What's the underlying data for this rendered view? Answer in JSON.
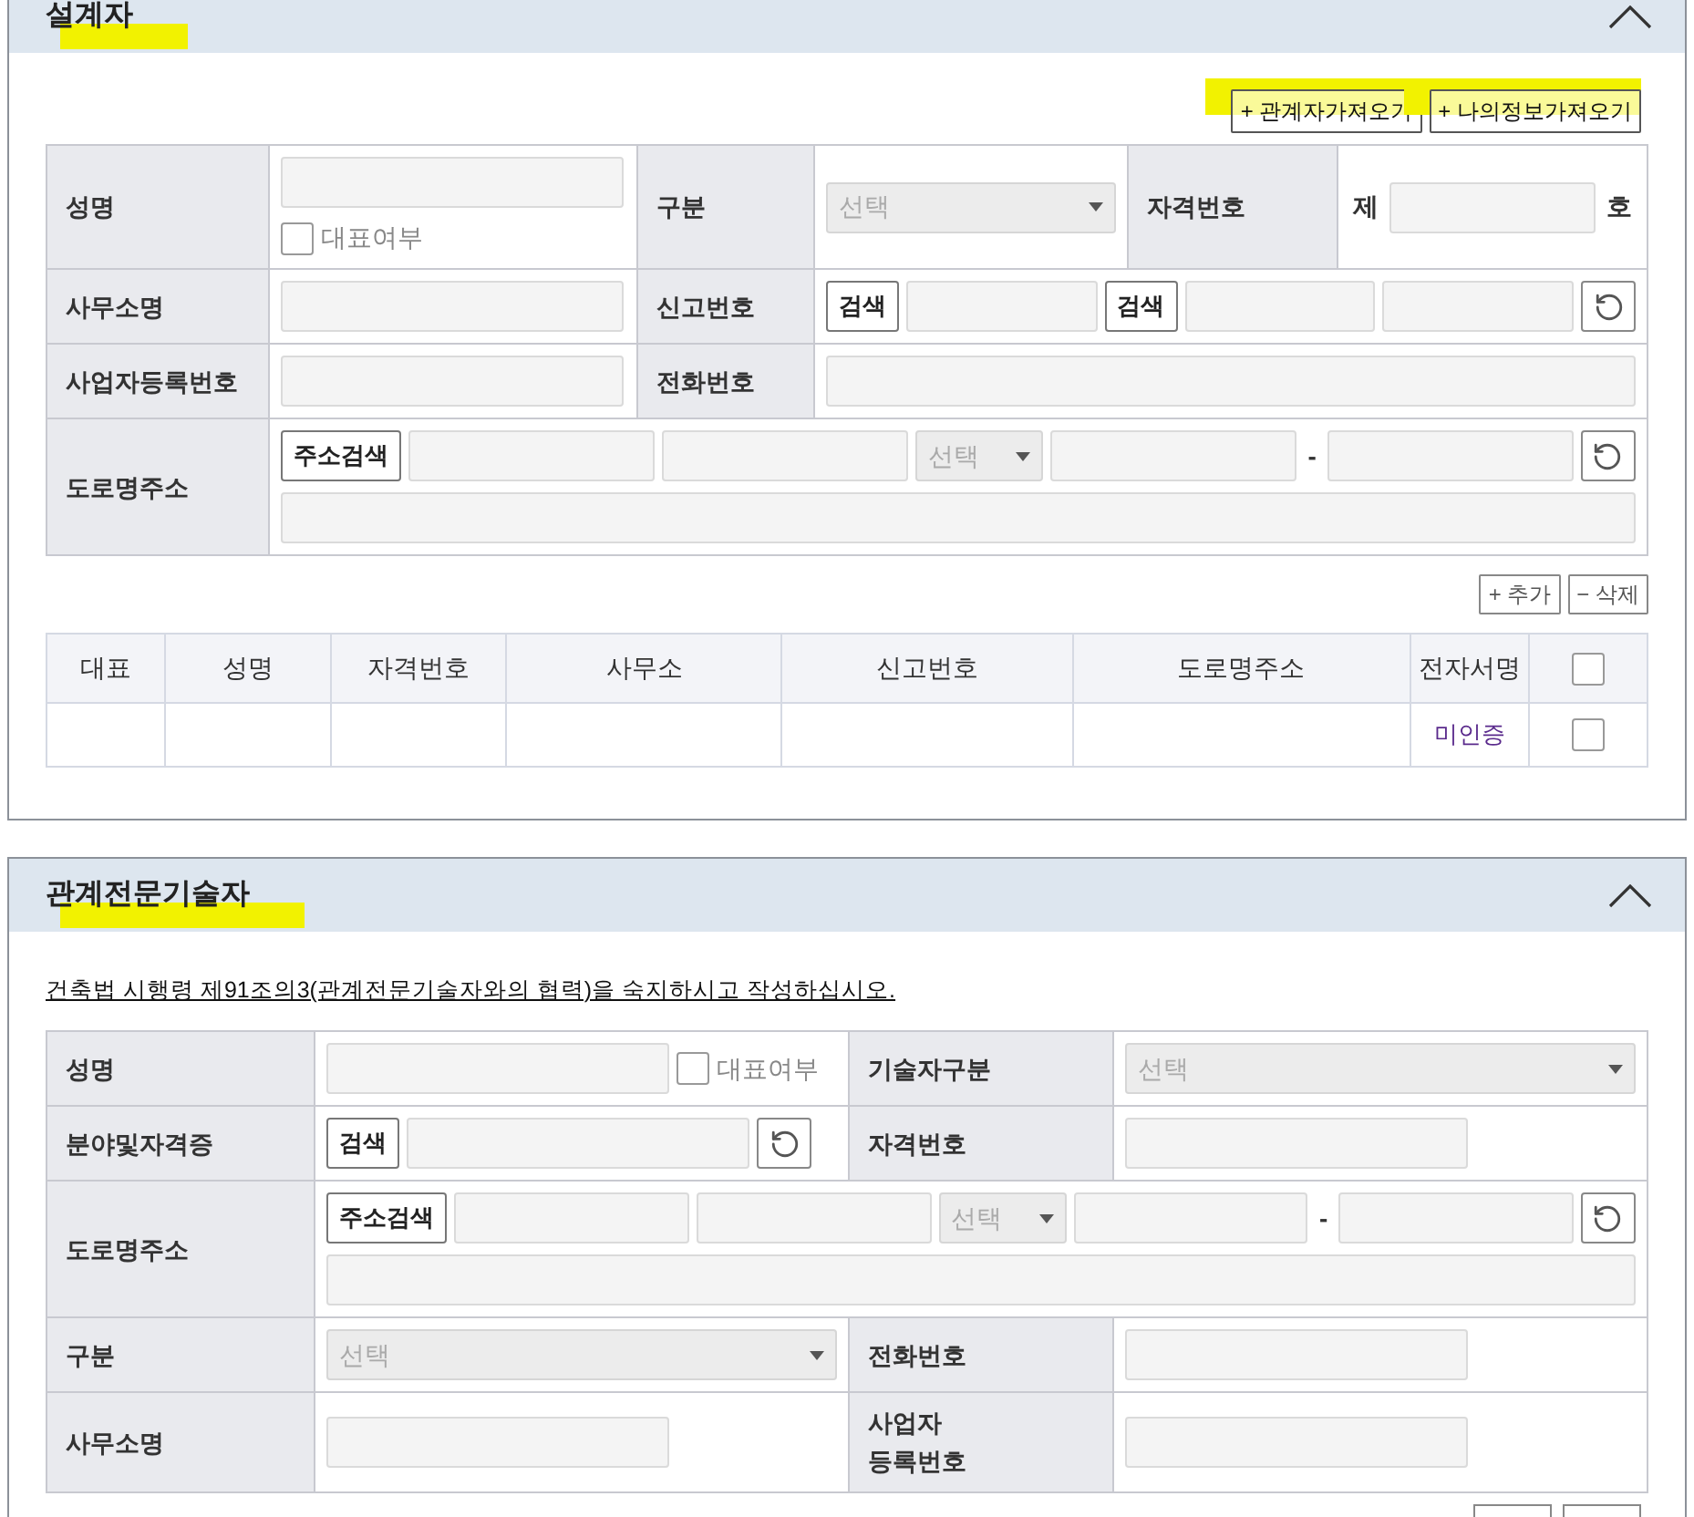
{
  "sections": [
    {
      "title": "설계자",
      "highlighted": true,
      "expanded": true,
      "actions": [
        {
          "label": "+ 관계자가져오기",
          "highlighted": true
        },
        {
          "label": "+ 나의정보가져오기",
          "highlighted": true
        }
      ],
      "form": [
        {
          "cells": [
            {
              "label": "성명",
              "lines": [
                [
                  {
                    "kind": "input"
                  }
                ],
                [
                  {
                    "kind": "checkbox",
                    "label": "대표여부",
                    "checked": false
                  }
                ]
              ]
            },
            {
              "label": "구분",
              "lines": [
                [
                  {
                    "kind": "select",
                    "placeholder": "선택"
                  }
                ]
              ]
            },
            {
              "label": "자격번호",
              "lines": [
                [
                  {
                    "kind": "text",
                    "text": "제"
                  },
                  {
                    "kind": "input"
                  },
                  {
                    "kind": "text",
                    "text": "호"
                  }
                ]
              ]
            }
          ]
        },
        {
          "cells": [
            {
              "label": "사무소명",
              "lines": [
                [
                  {
                    "kind": "input"
                  }
                ]
              ]
            },
            {
              "label": "신고번호",
              "lines": [
                [
                  {
                    "kind": "button",
                    "label": "검색"
                  },
                  {
                    "kind": "input"
                  },
                  {
                    "kind": "button",
                    "label": "검색"
                  },
                  {
                    "kind": "input"
                  },
                  {
                    "kind": "input"
                  },
                  {
                    "kind": "reset"
                  }
                ]
              ]
            }
          ]
        },
        {
          "cells": [
            {
              "label": "사업자등록번호",
              "lines": [
                [
                  {
                    "kind": "input"
                  }
                ]
              ]
            },
            {
              "label": "전화번호",
              "lines": [
                [
                  {
                    "kind": "input"
                  }
                ]
              ]
            }
          ]
        },
        {
          "cells": [
            {
              "label": "도로명주소",
              "lines": [
                [
                  {
                    "kind": "button",
                    "label": "주소검색"
                  },
                  {
                    "kind": "input"
                  },
                  {
                    "kind": "input"
                  },
                  {
                    "kind": "select",
                    "placeholder": "선택"
                  },
                  {
                    "kind": "input"
                  },
                  {
                    "kind": "text",
                    "text": "-"
                  },
                  {
                    "kind": "input"
                  },
                  {
                    "kind": "reset"
                  }
                ],
                [
                  {
                    "kind": "input"
                  }
                ]
              ]
            }
          ]
        }
      ],
      "list_actions": [
        "+ 추가",
        "− 삭제"
      ],
      "table": {
        "columns": [
          "대표",
          "성명",
          "자격번호",
          "사무소",
          "신고번호",
          "도로명주소",
          "전자서명"
        ],
        "select_all_checked": false,
        "rows": [
          {
            "electronic_signature": "미인증",
            "checked": false
          }
        ]
      }
    },
    {
      "title": "관계전문기술자",
      "highlighted": true,
      "expanded": true,
      "notice": "건축법 시행령 제91조의3(관계전문기술자와의 협력)을 숙지하시고 작성하십시오.",
      "form": [
        {
          "cells": [
            {
              "label": "성명",
              "lines": [
                [
                  {
                    "kind": "input"
                  },
                  {
                    "kind": "checkbox",
                    "label": "대표여부",
                    "checked": false
                  }
                ]
              ]
            },
            {
              "label": "기술자구분",
              "lines": [
                [
                  {
                    "kind": "select",
                    "placeholder": "선택"
                  }
                ]
              ]
            }
          ]
        },
        {
          "cells": [
            {
              "label": "분야및자격증",
              "lines": [
                [
                  {
                    "kind": "button",
                    "label": "검색"
                  },
                  {
                    "kind": "input"
                  },
                  {
                    "kind": "reset"
                  }
                ]
              ]
            },
            {
              "label": "자격번호",
              "lines": [
                [
                  {
                    "kind": "input"
                  }
                ]
              ]
            }
          ]
        },
        {
          "cells": [
            {
              "label": "도로명주소",
              "lines": [
                [
                  {
                    "kind": "button",
                    "label": "주소검색"
                  },
                  {
                    "kind": "input"
                  },
                  {
                    "kind": "input"
                  },
                  {
                    "kind": "select",
                    "placeholder": "선택"
                  },
                  {
                    "kind": "input"
                  },
                  {
                    "kind": "text",
                    "text": "-"
                  },
                  {
                    "kind": "input"
                  },
                  {
                    "kind": "reset"
                  }
                ],
                [
                  {
                    "kind": "input"
                  }
                ]
              ]
            }
          ]
        },
        {
          "cells": [
            {
              "label": "구분",
              "lines": [
                [
                  {
                    "kind": "select",
                    "placeholder": "선택"
                  }
                ]
              ]
            },
            {
              "label": "전화번호",
              "lines": [
                [
                  {
                    "kind": "input"
                  }
                ]
              ]
            }
          ]
        },
        {
          "cells": [
            {
              "label": "사무소명",
              "lines": [
                [
                  {
                    "kind": "input"
                  }
                ]
              ]
            },
            {
              "label": "사업자\n등록번호",
              "lines": [
                [
                  {
                    "kind": "input"
                  }
                ]
              ]
            }
          ]
        }
      ]
    }
  ]
}
